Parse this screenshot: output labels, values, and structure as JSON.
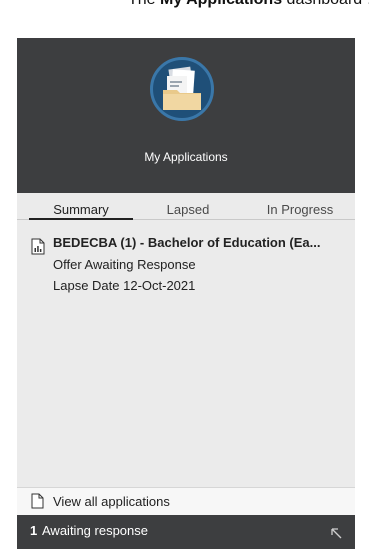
{
  "caption": {
    "prefix": "The ",
    "bold": "My Applications",
    "suffix": " dashboard …"
  },
  "widget": {
    "title": "My Applications",
    "tabs": [
      {
        "label": "Summary",
        "active": true
      },
      {
        "label": "Lapsed",
        "active": false
      },
      {
        "label": "In Progress",
        "active": false
      }
    ],
    "application": {
      "icon": "chart-document-icon",
      "title": "BEDECBA (1) - Bachelor of Education (Ea...",
      "status": "Offer Awaiting Response",
      "lapse_date": "Lapse Date 12-Oct-2021"
    },
    "view_all": {
      "icon": "file-icon",
      "label": "View all applications"
    },
    "footer": {
      "count": "1",
      "label": "Awaiting response",
      "icon": "expand-arrow-icon"
    }
  },
  "colors": {
    "header_bg": "#3d3e40",
    "panel_bg": "#ebebeb",
    "icon_circle": "#1f4f78",
    "folder": "#e9c98a"
  }
}
